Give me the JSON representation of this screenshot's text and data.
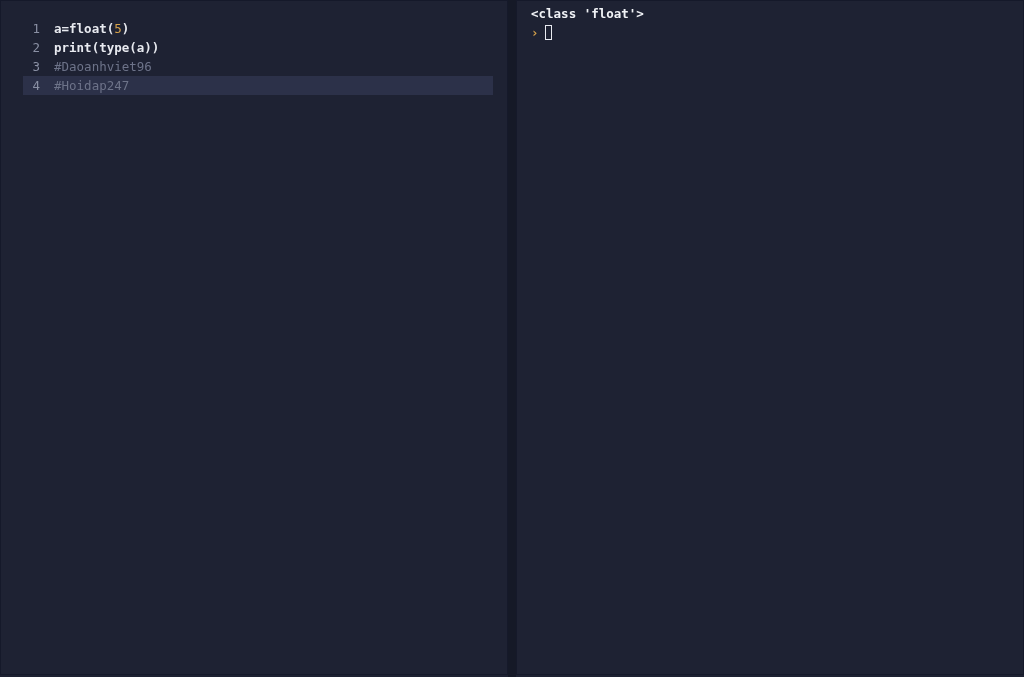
{
  "editor": {
    "lines": [
      {
        "number": "1",
        "selected": false,
        "tokens": [
          {
            "text": "a=float(",
            "kind": "plain"
          },
          {
            "text": "5",
            "kind": "number"
          },
          {
            "text": ")",
            "kind": "plain"
          }
        ]
      },
      {
        "number": "2",
        "selected": false,
        "tokens": [
          {
            "text": "print(type(a))",
            "kind": "plain"
          }
        ]
      },
      {
        "number": "3",
        "selected": false,
        "tokens": [
          {
            "text": "#Daoanhviet96",
            "kind": "comment"
          }
        ]
      },
      {
        "number": "4",
        "selected": true,
        "tokens": [
          {
            "text": "#Hoidap247",
            "kind": "comment"
          }
        ]
      }
    ]
  },
  "console": {
    "output": [
      "<class 'float'>"
    ],
    "prompt": "›"
  }
}
